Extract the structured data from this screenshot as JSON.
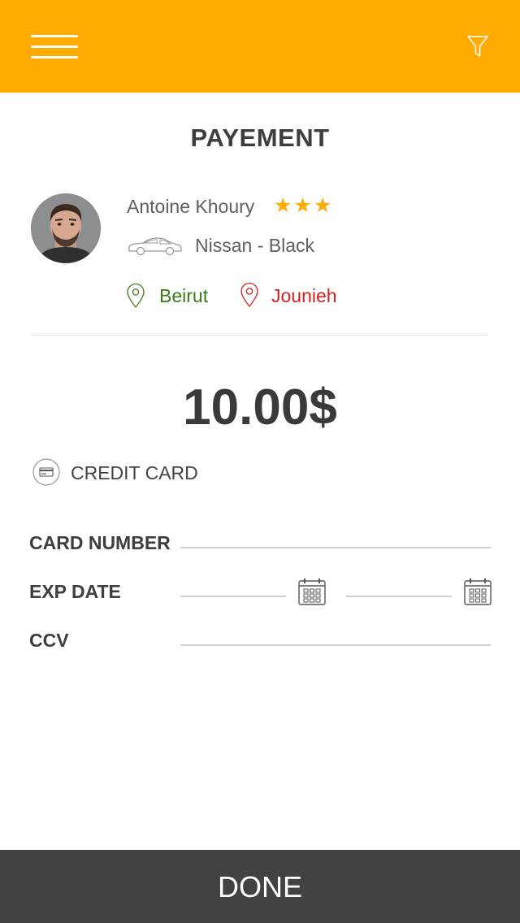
{
  "header": {
    "menu_icon": "hamburger-menu-icon",
    "filter_icon": "filter-funnel-icon",
    "accent_color": "#ffab00"
  },
  "page": {
    "title": "PAYEMENT"
  },
  "driver": {
    "name": "Antoine Khoury",
    "rating": 3,
    "rating_text": "★★★",
    "car": "Nissan - Black",
    "car_icon": "car-outline-icon"
  },
  "route": {
    "from": "Beirut",
    "to": "Jounieh",
    "from_color": "#3c7a1a",
    "to_color": "#d42020"
  },
  "payment": {
    "amount": "10.00$",
    "method": "CREDIT CARD",
    "method_icon": "credit-card-icon"
  },
  "form": {
    "card_number_label": "CARD NUMBER",
    "card_number_value": "",
    "exp_date_label": "EXP DATE",
    "exp_month_value": "",
    "exp_year_value": "",
    "ccv_label": "CCV",
    "ccv_value": "",
    "calendar_icon": "calendar-icon"
  },
  "footer": {
    "done_label": "DONE",
    "button_color": "#424242"
  }
}
